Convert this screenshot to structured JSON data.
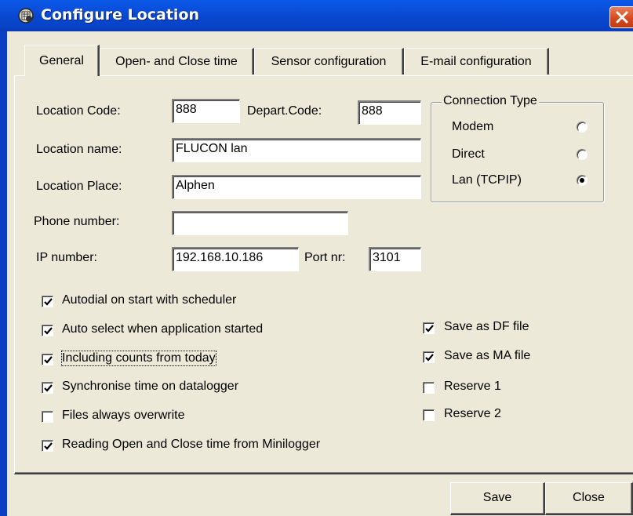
{
  "window": {
    "title": "Configure Location",
    "app_icon": "app-icon",
    "close_icon": "close-icon",
    "close_color": "#d6491e",
    "titlebar_color": "#0847cf"
  },
  "tabs": [
    {
      "label": "General",
      "active": true
    },
    {
      "label": "Open- and Close time",
      "active": false
    },
    {
      "label": "Sensor configuration",
      "active": false
    },
    {
      "label": "E-mail configuration",
      "active": false
    }
  ],
  "general": {
    "location_code": {
      "label": "Location Code:",
      "value": "888"
    },
    "depart_code": {
      "label": "Depart.Code:",
      "value": "888"
    },
    "location_name": {
      "label": "Location name:",
      "value": "FLUCON lan"
    },
    "location_place": {
      "label": "Location Place:",
      "value": "Alphen"
    },
    "phone_number": {
      "label": "Phone number:",
      "value": ""
    },
    "ip_number": {
      "label": "IP number:",
      "value": "192.168.10.186"
    },
    "port_nr": {
      "label": "Port nr:",
      "value": "3101"
    }
  },
  "connection_type": {
    "title": "Connection Type",
    "options": [
      {
        "label": "Modem",
        "selected": false
      },
      {
        "label": "Direct",
        "selected": false
      },
      {
        "label": "Lan (TCPIP)",
        "selected": true
      }
    ]
  },
  "options_left": [
    {
      "label": "Autodial on start with scheduler",
      "checked": true
    },
    {
      "label": "Auto select when application started",
      "checked": true
    },
    {
      "label": "Including counts from today",
      "checked": true,
      "focused": true
    },
    {
      "label": "Synchronise time on datalogger",
      "checked": true
    },
    {
      "label": "Files always overwrite",
      "checked": false
    },
    {
      "label": "Reading Open and Close time from Minilogger",
      "checked": true
    }
  ],
  "options_right": [
    {
      "label": "Save as DF file",
      "checked": true
    },
    {
      "label": "Save as MA file",
      "checked": true
    },
    {
      "label": "Reserve 1",
      "checked": false
    },
    {
      "label": "Reserve 2",
      "checked": false
    }
  ],
  "buttons": {
    "save": "Save",
    "close": "Close"
  }
}
